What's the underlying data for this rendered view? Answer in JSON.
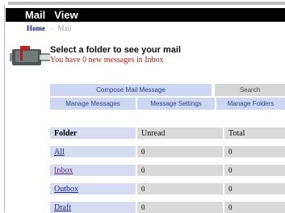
{
  "title_bar": {
    "items": [
      "Mail",
      "View"
    ]
  },
  "breadcrumb": {
    "home": "Home",
    "separator": "-",
    "current": "Mail"
  },
  "header": {
    "message": "Select a folder to see your mail",
    "new_messages": "You have 0 new messages in Inbox"
  },
  "menu": {
    "compose": "Compose Mail Message",
    "search": "Search",
    "manage_messages": "Manage Messages",
    "message_settings": "Message Settings",
    "manage_folders": "Manage Folders"
  },
  "folders_table": {
    "columns": [
      "Folder",
      "Unread",
      "Total"
    ],
    "rows": [
      {
        "folder": "All",
        "unread": "0",
        "total": "0"
      },
      {
        "folder": "Inbox",
        "unread": "0",
        "total": "0"
      },
      {
        "folder": "Outbox",
        "unread": "0",
        "total": "0"
      },
      {
        "folder": "Draft",
        "unread": "0",
        "total": "0"
      }
    ]
  },
  "colors": {
    "title_bar": "#000000",
    "menu_blue": "#cdd6f2",
    "menu_gray": "#d6d6d6",
    "link": "#1a22a6",
    "alert_red": "#d11a1a"
  },
  "icons": {
    "mailbox": "mailbox-icon"
  }
}
